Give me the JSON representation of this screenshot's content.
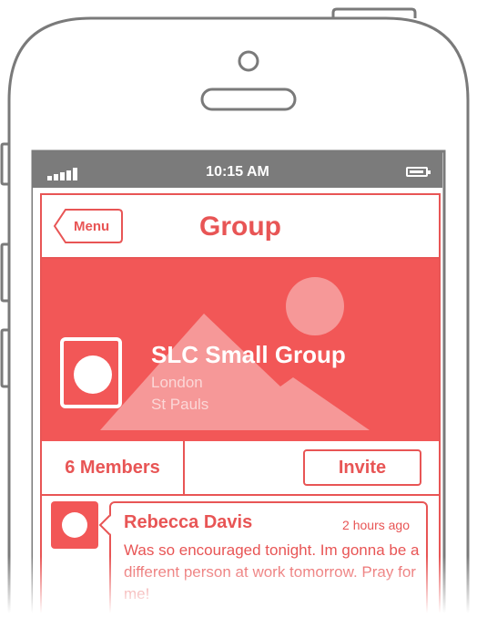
{
  "status_bar": {
    "time": "10:15 AM",
    "signal_icon": "signal-icon",
    "battery_icon": "battery-icon"
  },
  "nav": {
    "menu_label": "Menu",
    "title": "Group"
  },
  "group": {
    "name": "SLC Small Group",
    "line1": "London",
    "line2": "St Pauls",
    "avatar_icon": "group-avatar"
  },
  "stats": {
    "members_label": "6 Members",
    "invite_label": "Invite"
  },
  "feed": {
    "author": "Rebecca Davis",
    "time": "2 hours ago",
    "message": "Was so encouraged tonight.  Im gonna be a different person at work tomorrow. Pray for me!"
  },
  "colors": {
    "accent": "#e85555",
    "hero": "#f25757",
    "status_bar": "#7b7b7b"
  }
}
